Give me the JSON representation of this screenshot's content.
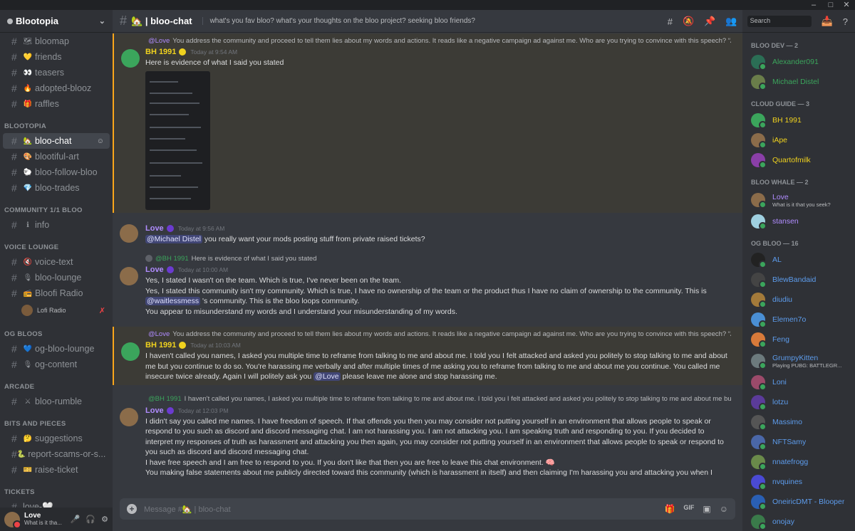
{
  "window": {
    "controls": [
      "–",
      "□",
      "✕"
    ]
  },
  "server": {
    "name": "Blootopia"
  },
  "sidebar": {
    "top_channels": [
      {
        "label": "bloomap",
        "emoji": "🗺"
      },
      {
        "label": "friends",
        "emoji": "💛"
      },
      {
        "label": "teasers",
        "emoji": "👀"
      },
      {
        "label": "adopted-blooz",
        "emoji": "🔥"
      },
      {
        "label": "raffles",
        "emoji": "🎁"
      }
    ],
    "cat_blootopia": "BLOOTOPIA",
    "blootopia_channels": [
      {
        "label": "bloo-chat",
        "emoji": "🏡",
        "active": true
      },
      {
        "label": "blootiful-art",
        "emoji": "🎨"
      },
      {
        "label": "bloo-follow-bloo",
        "emoji": "🐑"
      },
      {
        "label": "bloo-trades",
        "emoji": "💎"
      }
    ],
    "cat_community": "COMMUNITY 1/1 BLOO",
    "community_channels": [
      {
        "label": "info",
        "emoji": "ℹ"
      }
    ],
    "cat_voice": "VOICE LOUNGE",
    "voice_channels": [
      {
        "label": "voice-text",
        "emoji": "🔇"
      },
      {
        "label": "bloo-lounge",
        "emoji": "🎙"
      },
      {
        "label": "Bloofi Radio",
        "emoji": "📻"
      }
    ],
    "voice_sub": "Lofi Radio",
    "cat_og": "OG BLOOS",
    "og_channels": [
      {
        "label": "og-bloo-lounge",
        "emoji": "💙"
      },
      {
        "label": "og-content",
        "emoji": "🎙"
      }
    ],
    "cat_arcade": "ARCADE",
    "arcade_channels": [
      {
        "label": "bloo-rumble",
        "emoji": "⚔"
      }
    ],
    "cat_bits": "BITS AND PIECES",
    "bits_channels": [
      {
        "label": "suggestions",
        "emoji": "🤔"
      },
      {
        "label": "report-scams-or-s...",
        "emoji": "🐍"
      },
      {
        "label": "raise-ticket",
        "emoji": "🎫"
      }
    ],
    "cat_tickets": "TICKETS",
    "tickets_channels": [
      {
        "label": "love-🤍",
        "emoji": ""
      }
    ]
  },
  "user": {
    "name": "Love",
    "status": "What is it tha..."
  },
  "header": {
    "channel": "🏡 | bloo-chat",
    "topic": "what's you fav bloo? what's your thoughts on the bloo project? seeking bloo friends?",
    "search_placeholder": "Search"
  },
  "messages": {
    "m1": {
      "reply_name": "@Love",
      "reply_text": "You address the community and proceed to tell them lies about my words and actions. It reads like a negative campaign ad against me. Who are you trying to convince with this speech? “As a member ...",
      "author": "BH 1991",
      "time": "Today at 9:54 AM",
      "text": "Here is evidence of what I said you stated"
    },
    "m2": {
      "author": "Love",
      "time": "Today at 9:56 AM",
      "mention": "@Michael Distel",
      "text": " you really want your mods posting stuff from private raised tickets?"
    },
    "m3": {
      "reply_name": "@BH 1991",
      "reply_text": "Here is evidence of what I said you stated",
      "author": "Love",
      "time": "Today at 10:00 AM",
      "line1": "Yes, I stated I wasn't on the team. Which is true, I've never been on the team.",
      "line2": "Yes, I stated this community isn't my community. Which is true, I have no ownership of the team or the product thus I have no claim of ownership to the community. This is",
      "mention": "@waitlessmess",
      "line3": " 's community. This is the bloo loops community.",
      "line4": "You appear to misunderstand my words and I understand your misunderstanding of my words."
    },
    "m4": {
      "reply_name": "@Love",
      "reply_text": "You address the community and proceed to tell them lies about my words and actions. It reads like a negative campaign ad against me. Who are you trying to convince with this speech? “As a member ...",
      "author": "BH 1991",
      "time": "Today at 10:03 AM",
      "text_a": "I haven't called you names, I asked you multiple time to reframe from talking to me and about me. I told you I felt attacked and asked you politely to stop talking to me and about me but you continue to do so. You're harassing me verbally and after multiple times of me asking you to reframe  from talking to me and about me you continue. You called me insecure twice already.  Again I will politely ask you",
      "mention": "@Love",
      "text_b": " please leave me alone and stop harassing me."
    },
    "m5": {
      "reply_name": "@BH 1991",
      "reply_text": "I haven't called you names, I asked you multiple time to reframe from talking to me and about me. I told you I felt attacked and asked you politely to stop talking to me and about me but you continue...",
      "author": "Love",
      "time": "Today at 12:03 PM",
      "p1": "I didn't say you called me names. I have freedom of speech. If that offends you then you may consider not putting yourself in an environment that allows people to speak or respond to you such as discord and discord messaging chat. I am not harassing you. I am not attacking you. I am speaking truth and responding to you. If you decided to interpret my responses of truth as harassment and attacking you then again, you may consider not putting yourself in an environment that allows people to speak or respond to you such as discord and discord messaging chat.",
      "p2": "I have free speech and I am free to respond to you. If you don't like that then you are free to leave this chat environment. 🧠",
      "p3": "You making false statements about me publicly directed toward this community (which is harassment in itself) and then claiming I'm harassing you and attacking you when I respond to your initial false statements is harassment. Google it. If you don't want my response then maybe you shouldn't make the false statements about me in the first place. Something to consider 🧠"
    }
  },
  "composer": {
    "placeholder": "Message #🏡 | bloo-chat"
  },
  "members": {
    "groups": [
      {
        "title": "BLOO DEV — 2",
        "items": [
          {
            "name": "Alexander091",
            "color": "#3ba55c",
            "av": "#2b6e55"
          },
          {
            "name": "Michael Distel",
            "color": "#3ba55c",
            "av": "#6a7d4a"
          }
        ]
      },
      {
        "title": "CLOUD GUIDE — 3",
        "items": [
          {
            "name": "BH 1991",
            "color": "#f0d21e",
            "av": "#3ba55c"
          },
          {
            "name": "iApe",
            "color": "#f0d21e",
            "av": "#8b6c4a"
          },
          {
            "name": "Quartofmilk",
            "color": "#f0d21e",
            "av": "#8a3fa8"
          }
        ]
      },
      {
        "title": "BLOO WHALE — 2",
        "items": [
          {
            "name": "Love",
            "color": "#b08cff",
            "av": "#8b6c4a",
            "status": "What is it that you seek?"
          },
          {
            "name": "stansen",
            "color": "#b08cff",
            "av": "#9fd0e0"
          }
        ]
      },
      {
        "title": "OG BLOO — 16",
        "items": [
          {
            "name": "AL",
            "color": "#5d9cec",
            "av": "#222"
          },
          {
            "name": "BlewBandaid",
            "color": "#5d9cec",
            "av": "#444"
          },
          {
            "name": "diudiu",
            "color": "#5d9cec",
            "av": "#a37a3a"
          },
          {
            "name": "Elemen7o",
            "color": "#5d9cec",
            "av": "#4a8fd4"
          },
          {
            "name": "Feng",
            "color": "#5d9cec",
            "av": "#d87a3a"
          },
          {
            "name": "GrumpyKitten",
            "color": "#5d9cec",
            "av": "#6c7a7d",
            "status": "Playing PUBG: BATTLEGR..."
          },
          {
            "name": "Loni",
            "color": "#5d9cec",
            "av": "#9b4a6a"
          },
          {
            "name": "lotzu",
            "color": "#5d9cec",
            "av": "#5b3b9a"
          },
          {
            "name": "Massimo",
            "color": "#5d9cec",
            "av": "#555"
          },
          {
            "name": "NFTSamy",
            "color": "#5d9cec",
            "av": "#4a67a8"
          },
          {
            "name": "nnatefrogg",
            "color": "#5d9cec",
            "av": "#6a8a4a"
          },
          {
            "name": "nvquines",
            "color": "#5d9cec",
            "av": "#4a4ad4"
          },
          {
            "name": "OneiricDMT - Blooper",
            "color": "#5d9cec",
            "av": "#2a5fb4"
          },
          {
            "name": "onojay",
            "color": "#5d9cec",
            "av": "#3a7a4a"
          }
        ]
      }
    ]
  }
}
